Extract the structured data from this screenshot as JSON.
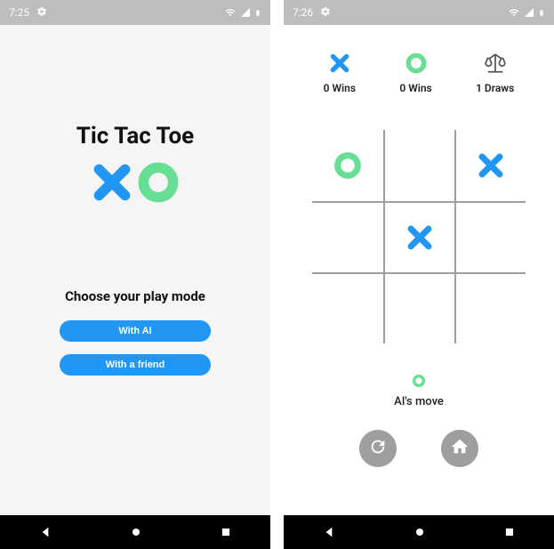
{
  "colors": {
    "x": "#2196F3",
    "o": "#66DE93",
    "grid": "#9e9e9e",
    "button": "#2196F3",
    "ctrl": "#9e9e9e"
  },
  "left": {
    "status_time": "7:25",
    "title": "Tic Tac Toe",
    "choose_label": "Choose your play mode",
    "btn_ai": "With AI",
    "btn_friend": "With a friend"
  },
  "right": {
    "status_time": "7:26",
    "scores": {
      "x_label": "0 Wins",
      "o_label": "0 Wins",
      "draws_label": "1 Draws"
    },
    "board": [
      "O",
      "",
      "X",
      "",
      "X",
      "",
      "",
      "",
      ""
    ],
    "turn_label": "AI's move",
    "turn_marker": "O"
  }
}
